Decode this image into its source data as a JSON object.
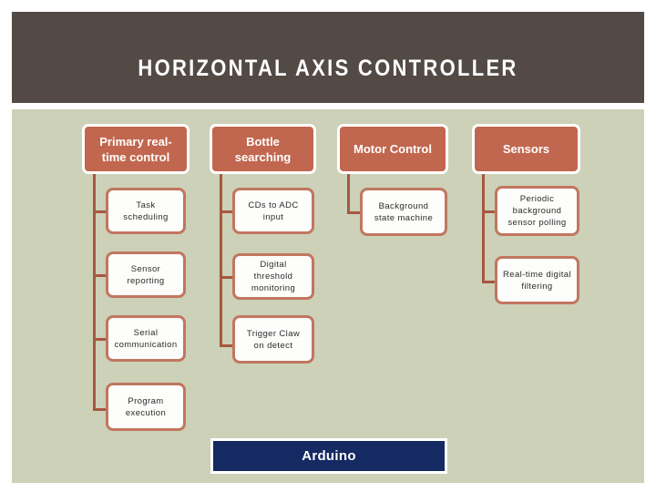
{
  "header": {
    "title": "HORIZONTAL AXIS CONTROLLER",
    "background_color": "#534a46",
    "text_color": "#ffffff"
  },
  "body": {
    "background_color": "#ccd1b8"
  },
  "palette": {
    "root_box_fill": "#c2674f",
    "root_box_border": "#ffffff",
    "child_box_fill": "#fdfdfb",
    "child_box_border": "#c2765f",
    "connector": "#a8573f",
    "footer_fill": "#152a62"
  },
  "diagram": {
    "columns": [
      {
        "root": "Primary real-time control",
        "children": [
          "Task scheduling",
          "Sensor reporting",
          "Serial communication",
          "Program execution"
        ]
      },
      {
        "root": "Bottle searching",
        "children": [
          "CDs to ADC input",
          "Digital threshold monitoring",
          "Trigger Claw on detect"
        ]
      },
      {
        "root": "Motor Control",
        "children": [
          "Background state machine"
        ]
      },
      {
        "root": "Sensors",
        "children": [
          "Periodic background sensor polling",
          "Real-time digital filtering"
        ]
      }
    ]
  },
  "footer": {
    "label": "Arduino"
  }
}
